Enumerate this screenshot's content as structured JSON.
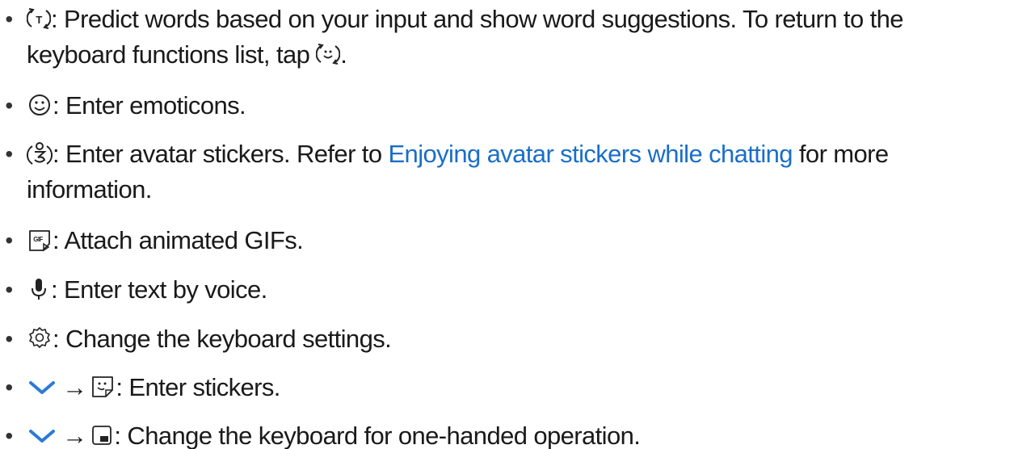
{
  "items": [
    {
      "icon": "predictive-text-icon",
      "text_line1": ": Predict words based on your input and show word suggestions. To return to the",
      "text_line2_before": "keyboard functions list, tap ",
      "text_line2_icon": "emoticon-refresh-icon",
      "text_line2_after": "."
    },
    {
      "icon": "emoticon-icon",
      "text": ": Enter emoticons."
    },
    {
      "icon": "avatar-sticker-icon",
      "text_before_link": ": Enter avatar stickers. Refer to ",
      "link_text": "Enjoying avatar stickers while chatting",
      "text_after_link": " for more",
      "text_line2": "information."
    },
    {
      "icon": "gif-icon",
      "text": ": Attach animated GIFs."
    },
    {
      "icon": "microphone-icon",
      "text": ": Enter text by voice."
    },
    {
      "icon": "gear-icon",
      "text": ": Change the keyboard settings."
    },
    {
      "icon_first": "chevron-down-icon",
      "arrow": "→",
      "icon": "sticker-icon",
      "text": ": Enter stickers."
    },
    {
      "icon_first": "chevron-down-icon",
      "arrow": "→",
      "icon": "one-handed-keyboard-icon",
      "text": ": Change the keyboard for one-handed operation."
    }
  ],
  "bullet": "•",
  "colors": {
    "text": "#1a1a1a",
    "link": "#1a6ec8",
    "chevron": "#2b7bd6"
  }
}
